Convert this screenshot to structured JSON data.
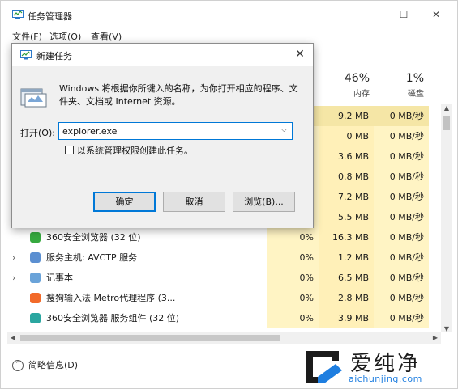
{
  "window": {
    "title": "任务管理器",
    "minimize_glyph": "–",
    "maximize_glyph": "☐",
    "close_glyph": "✕"
  },
  "menu": [
    "文件(F)",
    "选项(O)",
    "查看(V)"
  ],
  "columns": {
    "memory": {
      "percent": "46%",
      "label": "内存"
    },
    "disk": {
      "percent": "1%",
      "label": "磁盘"
    }
  },
  "rows": [
    {
      "name": "",
      "cpu": "",
      "mem": "9.2 MB",
      "disk": "0 MB/秒",
      "expander": "",
      "icon": ""
    },
    {
      "name": "",
      "cpu": "",
      "mem": "0 MB",
      "disk": "0 MB/秒",
      "expander": "",
      "icon": ""
    },
    {
      "name": "",
      "cpu": "",
      "mem": "3.6 MB",
      "disk": "0 MB/秒",
      "expander": "",
      "icon": ""
    },
    {
      "name": "",
      "cpu": "",
      "mem": "0.8 MB",
      "disk": "0 MB/秒",
      "expander": "",
      "icon": ""
    },
    {
      "name": "",
      "cpu": "",
      "mem": "7.2 MB",
      "disk": "0 MB/秒",
      "expander": "",
      "icon": ""
    },
    {
      "name": "",
      "cpu": "",
      "mem": "5.5 MB",
      "disk": "0 MB/秒",
      "expander": "",
      "icon": ""
    },
    {
      "name": "360安全浏览器 (32 位)",
      "cpu": "0%",
      "mem": "16.3 MB",
      "disk": "0 MB/秒",
      "expander": "",
      "icon": "browser-360-icon"
    },
    {
      "name": "服务主机: AVCTP 服务",
      "cpu": "0%",
      "mem": "1.2 MB",
      "disk": "0 MB/秒",
      "expander": "›",
      "icon": "service-host-icon"
    },
    {
      "name": "记事本",
      "cpu": "0%",
      "mem": "6.5 MB",
      "disk": "0 MB/秒",
      "expander": "›",
      "icon": "notepad-icon"
    },
    {
      "name": "搜狗输入法 Metro代理程序 (3...",
      "cpu": "0%",
      "mem": "2.8 MB",
      "disk": "0 MB/秒",
      "expander": "",
      "icon": "sogou-icon"
    },
    {
      "name": "360安全浏览器 服务组件 (32 位)",
      "cpu": "0%",
      "mem": "3.9 MB",
      "disk": "0 MB/秒",
      "expander": "",
      "icon": "browser-360-service-icon"
    }
  ],
  "statusbar": {
    "fewer_details": "简略信息(D)"
  },
  "watermark": {
    "text": "爱纯净",
    "url": "aichunjing.com"
  },
  "dialog": {
    "title": "新建任务",
    "description": "Windows 将根据你所键入的名称，为你打开相应的程序、文件夹、文档或 Internet 资源。",
    "open_label": "打开(O):",
    "open_value": "explorer.exe",
    "admin_label": "以系统管理权限创建此任务。",
    "ok": "确定",
    "cancel": "取消",
    "browse": "浏览(B)..."
  },
  "colors": {
    "cpu_cell": "#fff4c4",
    "mem_cell": "#fff0b8",
    "accent": "#0078d7",
    "watermark_url": "#1e7ee0"
  }
}
